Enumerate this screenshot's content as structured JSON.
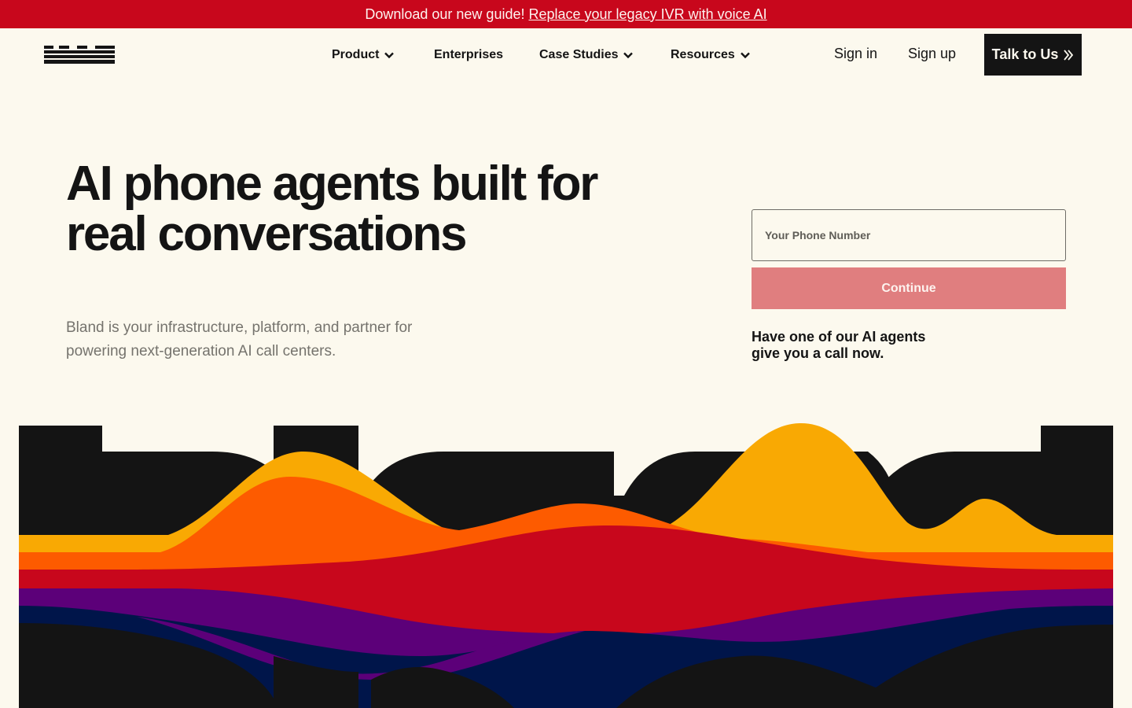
{
  "banner": {
    "text": "Download our new guide!",
    "link_text": "Replace your legacy IVR with voice AI",
    "background": "#c8071c"
  },
  "header": {
    "logo": "bland-logo",
    "nav": [
      {
        "label": "Product",
        "icon": "chevron-down-icon"
      },
      {
        "label": "Enterprises"
      },
      {
        "label": "Case Studies",
        "icon": "chevron-down-icon"
      },
      {
        "label": "Resources",
        "icon": "chevron-down-icon"
      }
    ],
    "sign_in": "Sign in",
    "sign_up": "Sign up",
    "cta": {
      "label": "Talk to Us",
      "icon": "double-chevron-right-icon"
    }
  },
  "hero": {
    "title_line1": "AI phone agents built for",
    "title_line2": "real conversations",
    "subtitle_line1": "Bland is your infrastructure, platform, and partner for",
    "subtitle_line2": "powering next-generation AI call centers."
  },
  "signup_form": {
    "phone_placeholder": "Your Phone Number",
    "continue_label": "Continue",
    "note_line1": "Have one of our AI agents",
    "note_line2": "give you a call now."
  },
  "colors": {
    "background": "#fcf9ee",
    "ink": "#141414",
    "brand_red": "#c8071c",
    "amber": "#f9a903",
    "orange": "#fd5b00",
    "purple": "#5c0079",
    "navy": "#00154a",
    "button_disabled": "#e07e7f"
  }
}
